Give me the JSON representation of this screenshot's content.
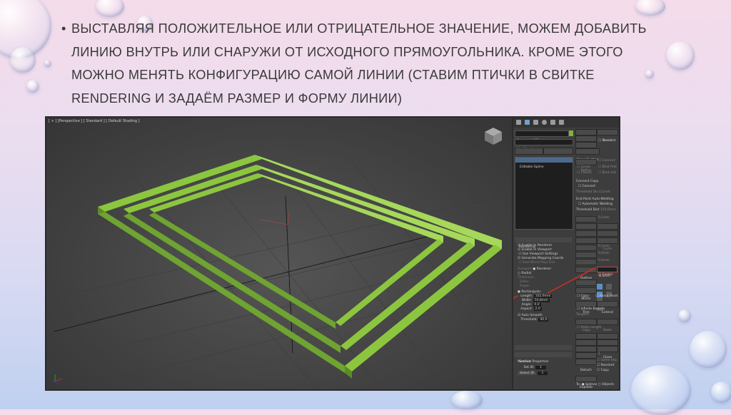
{
  "slide": {
    "bullet": "•",
    "lines": [
      "выставляя положительное или отрицательное значение, можем добавить",
      "линию внутрь или снаружи от исходного прямоугольника.  Кроме этого",
      "можно менять конфигурацию самой линии (ставим птички в свитке",
      "Rendering и задаём размер и форму линии)"
    ]
  },
  "viewport": {
    "label": "[ + ] [Perspective ] [ Standard ] [ Default Shading ]",
    "object_color": "#7fb33a"
  },
  "panel": {
    "object_name": "Rectangle001",
    "modifier_list": "Modifier List",
    "buttons_top": [
      "Quad Chamfer",
      "FloorGenerator"
    ],
    "stack_item": "Editable Spline",
    "rendering": {
      "header": "Rendering",
      "checks": [
        "Enable In Renderer",
        "Enable In Viewport",
        "Use Viewport Settings",
        "Generate Mapping Coords.",
        "Real-World Map Size"
      ],
      "viewport_radio": "Viewport",
      "renderer_radio": "Renderer",
      "radial": "Radial",
      "thickness": "Thickness:",
      "sides": "Sides:",
      "angle": "Angle:",
      "rectangular": "Rectangular",
      "length_label": "Length:",
      "length_value": "102,9mm",
      "width_label": "Width:",
      "width_value": "50,8mm",
      "angle_label": "Angle:",
      "angle_value": "0,0",
      "aspect_label": "Aspect:",
      "aspect_value": "2,0",
      "auto_smooth": "Auto Smooth",
      "threshold_label": "Threshold:",
      "threshold_value": "40,0"
    },
    "interpolation": "Interpolation",
    "surface": {
      "header": "Surface Properties",
      "material": "Material:",
      "set_id": "Set ID:",
      "set_id_value": "1",
      "select_id": "Select ID",
      "select_id_value": "1"
    },
    "geometry": {
      "create_line": "Create Line",
      "break": "Break",
      "attach": "Attach",
      "reorient": "Reorient",
      "attach_mult": "Attach Mult.",
      "cross_section": "Cross Section",
      "refine": "Refine",
      "connect": "Connect",
      "linear": "Linear",
      "bind_first": "Bind first",
      "closed": "Closed",
      "bind_last": "Bind last",
      "connect_copy": "Connect Copy",
      "connect_check": "Connect",
      "threshold_label": "Threshold Dis",
      "threshold_value": "0,1mm",
      "end_point": "End Point Auto-Welding",
      "auto_welding": "Automatic Welding",
      "threshold_dist": "Threshold Dist",
      "threshold_dist_value": "150,0mm",
      "weld": "Weld",
      "weld_value": "0,1mm",
      "connect_btn": "Connect",
      "insert": "Insert",
      "make_first": "Make First",
      "fuse": "Fuse",
      "reverse": "Reverse",
      "cycle": "Cycle",
      "crossinsert": "CrossInsert",
      "crossinsert_value": "0,1mm",
      "fillet": "Fillet",
      "fillet_value": "0,0mm",
      "chamfer": "Chamfer",
      "chamfer_value": "0,0mm",
      "outline": "Outline",
      "outline_value": "8,4mm",
      "mirror_check": "Center",
      "boolean": "Boolean",
      "mirror": "Mirror",
      "copy": "Copy",
      "about_pivot": "About Pivot",
      "trim": "Trim",
      "extend": "Extend",
      "infinite_bounds": "Infinite Bounds",
      "tangent": "Tangent",
      "copy2": "Copy",
      "paste": "Paste",
      "paste_length": "Paste Length",
      "hide": "Hide",
      "unhide_all": "Unhide All",
      "bind": "Bind",
      "unbind": "Unbind",
      "delete": "Delete",
      "close": "Close",
      "divide": "Divide",
      "divide_value": "1",
      "detach": "Detach",
      "same_shp": "Same Shp",
      "reorient2": "Reorient",
      "copy3": "Copy",
      "explode": "Explode",
      "to": "To:",
      "splines": "Splines",
      "objects": "Objects"
    }
  }
}
